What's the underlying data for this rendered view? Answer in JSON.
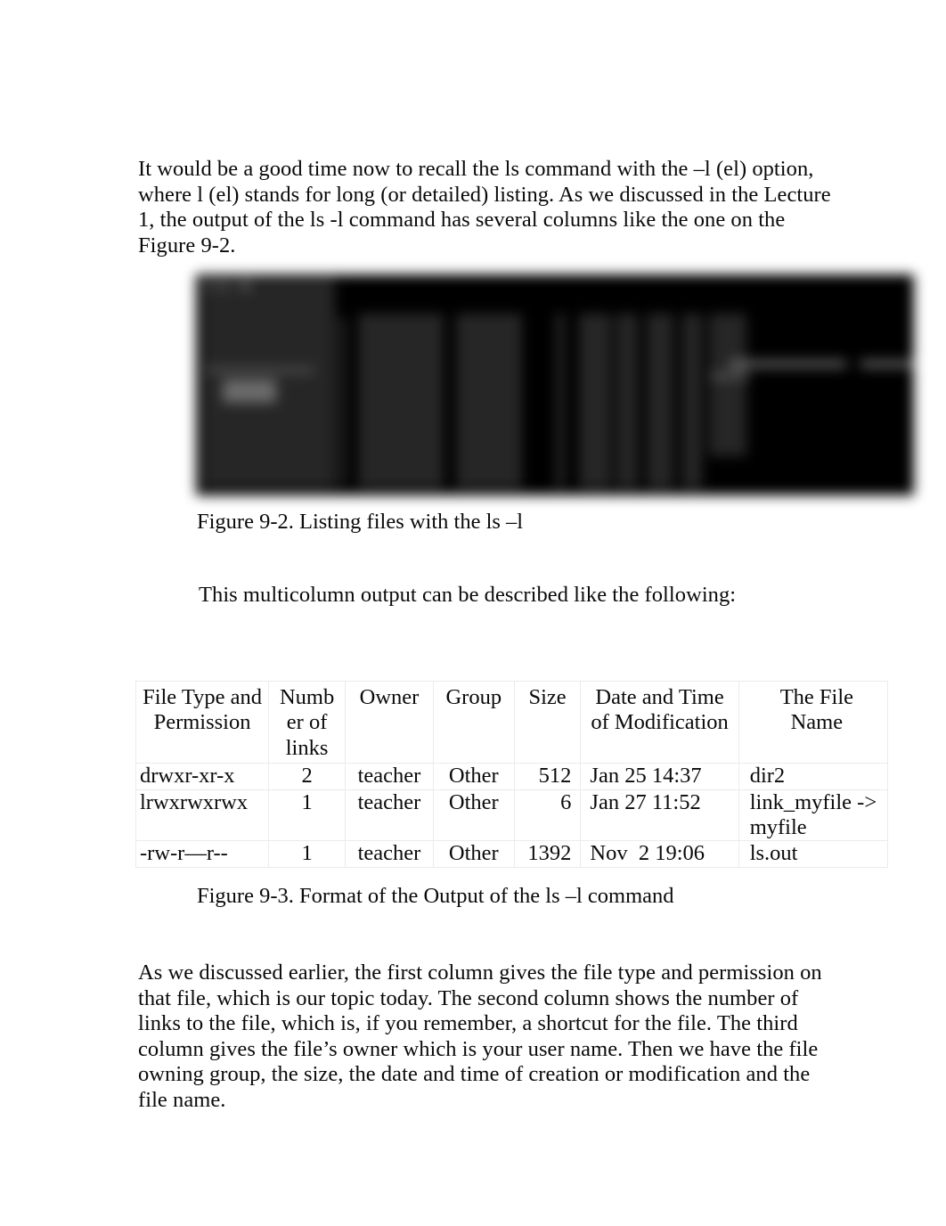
{
  "document": {
    "paragraphs": {
      "intro": "It would be a good time now to recall the ls command with the –l (el) option, where l (el) stands for long (or detailed) listing. As we discussed in the Lecture 1, the output of the ls -l command has several columns like the one on the Figure 9-2.",
      "multicolumn": "This multicolumn output can be described like the following:",
      "final": "As we discussed earlier, the first column gives the file type and permission on that file, which is our topic today. The second column shows the number of links to the file, which is, if you remember, a shortcut for the file. The third column gives the file’s owner which is your user name. Then we have the file owning group, the size, the date and time of creation or modification and the file name."
    },
    "captions": {
      "figure_9_2": "Figure 9-2. Listing files with the ls –l",
      "figure_9_3": "Figure 9-3. Format of the Output of the ls –l command"
    },
    "figure_9_2": {
      "alt": "Blurred terminal screenshot of ls -l output",
      "background_color": "#000000",
      "text_color": "#9a9a9a"
    }
  },
  "table": {
    "headers": [
      "File Type and Permission",
      "Numb er of links",
      "Owner",
      "Group",
      "Size",
      "Date and Time of Modification",
      "The File Name"
    ],
    "rows": [
      {
        "permission": "drwxr-xr-x",
        "links": "2",
        "owner": "teacher",
        "group": "Other",
        "size": "512",
        "date": "Jan 25 14:37",
        "name": "dir2"
      },
      {
        "permission": "lrwxrwxrwx",
        "links": "1",
        "owner": "teacher",
        "group": "Other",
        "size": "6",
        "date": "Jan 27 11:52",
        "name": "link_myfile -> myfile"
      },
      {
        "permission": "-rw-r—r--",
        "links": "1",
        "owner": "teacher",
        "group": "Other",
        "size": "1392",
        "date": "Nov  2 19:06",
        "name": "ls.out"
      }
    ],
    "border_color": "#ebebeb"
  }
}
